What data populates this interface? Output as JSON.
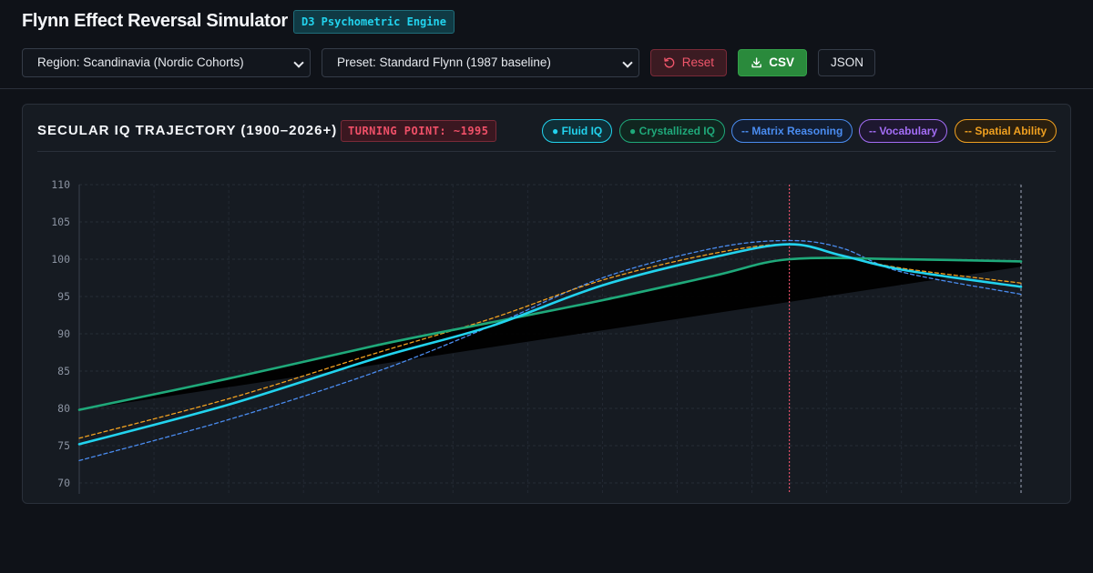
{
  "header": {
    "title": "Flynn Effect Reversal Simulator",
    "engine_badge": "D3 Psychometric Engine",
    "region_select": "Region: Scandinavia (Nordic Cohorts)",
    "preset_select": "Preset: Standard Flynn (1987 baseline)",
    "reset_label": "Reset",
    "csv_label": "CSV",
    "json_label": "JSON"
  },
  "panel": {
    "title": "SECULAR IQ TRAJECTORY (1900–2026+)",
    "turning_badge": "TURNING POINT: ~1995"
  },
  "legend": [
    {
      "label": "● Fluid IQ",
      "color": "#22d3ee",
      "bg": "#0f2f37"
    },
    {
      "label": "● Crystallized IQ",
      "color": "#1fa97a",
      "bg": "#10261f"
    },
    {
      "label": "-- Matrix Reasoning",
      "color": "#4a8cf0",
      "bg": "#121d31"
    },
    {
      "label": "-- Vocabulary",
      "color": "#a36df5",
      "bg": "#1e1730"
    },
    {
      "label": "-- Spatial Ability",
      "color": "#f0a020",
      "bg": "#2a1f0f"
    }
  ],
  "colors": {
    "fluid": "#22d3ee",
    "crystallized": "#1fa97a",
    "matrix": "#4a8cf0",
    "spatial": "#f0a020",
    "turning": "#e05068",
    "current": "#8a93a3"
  },
  "chart_data": {
    "type": "line",
    "xlim": [
      1900,
      2026
    ],
    "ylim": [
      70,
      110
    ],
    "yticks": [
      70,
      75,
      80,
      85,
      90,
      95,
      100,
      105,
      110
    ],
    "turning_point_year": 1995,
    "grid": true,
    "series": [
      {
        "name": "Fluid IQ",
        "style": "solid",
        "points": [
          [
            1900,
            75.2
          ],
          [
            1920,
            80.5
          ],
          [
            1940,
            86.8
          ],
          [
            1955,
            91.0
          ],
          [
            1970,
            96.5
          ],
          [
            1985,
            100.3
          ],
          [
            1995,
            102.0
          ],
          [
            2002,
            100.5
          ],
          [
            2010,
            98.6
          ],
          [
            2026,
            96.3
          ]
        ]
      },
      {
        "name": "Crystallized IQ",
        "style": "solid",
        "points": [
          [
            1900,
            79.8
          ],
          [
            1920,
            84.0
          ],
          [
            1940,
            88.5
          ],
          [
            1955,
            91.5
          ],
          [
            1970,
            94.5
          ],
          [
            1985,
            97.8
          ],
          [
            1995,
            100.0
          ],
          [
            2010,
            100.0
          ],
          [
            2026,
            99.7
          ]
        ]
      },
      {
        "name": "Matrix Reasoning",
        "style": "dashed",
        "points": [
          [
            1900,
            73.0
          ],
          [
            1920,
            78.5
          ],
          [
            1940,
            85.0
          ],
          [
            1955,
            91.0
          ],
          [
            1970,
            97.5
          ],
          [
            1985,
            101.5
          ],
          [
            1995,
            102.5
          ],
          [
            2002,
            101.5
          ],
          [
            2010,
            98.3
          ],
          [
            2026,
            95.3
          ]
        ]
      },
      {
        "name": "Spatial Ability",
        "style": "dashed",
        "points": [
          [
            1900,
            76.0
          ],
          [
            1920,
            81.3
          ],
          [
            1940,
            87.5
          ],
          [
            1955,
            92.0
          ],
          [
            1970,
            97.2
          ],
          [
            1985,
            100.8
          ],
          [
            1995,
            102.0
          ],
          [
            2002,
            100.5
          ],
          [
            2010,
            98.8
          ],
          [
            2026,
            96.8
          ]
        ]
      },
      {
        "name": "Vocabulary",
        "style": "dashed",
        "points": []
      }
    ]
  }
}
